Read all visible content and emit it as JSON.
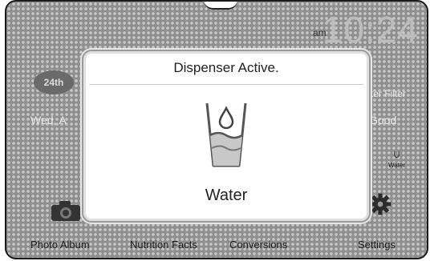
{
  "status": {
    "time": "10:24",
    "ampm": "am"
  },
  "left_widget": {
    "badge": "24th",
    "date_text": "Wed, A"
  },
  "right_widget": {
    "filter_label": "ter Filter",
    "filter_status": "Good",
    "mini_water_label": "Water"
  },
  "dialog": {
    "title": "Dispenser Active.",
    "label": "Water",
    "icon": "water-glass-icon"
  },
  "dock": {
    "items": [
      {
        "label": "Photo Album",
        "icon": "camera-icon"
      },
      {
        "label": "Nutrition Facts",
        "icon": "nutrition-icon"
      },
      {
        "label": "Conversions",
        "icon": "conversions-icon"
      },
      {
        "label": "Settings",
        "icon": "gear-icon"
      }
    ]
  },
  "colors": {
    "screen_bg": "#8f8f8f",
    "dialog_bg": "#ffffff",
    "text_dark": "#222222"
  }
}
